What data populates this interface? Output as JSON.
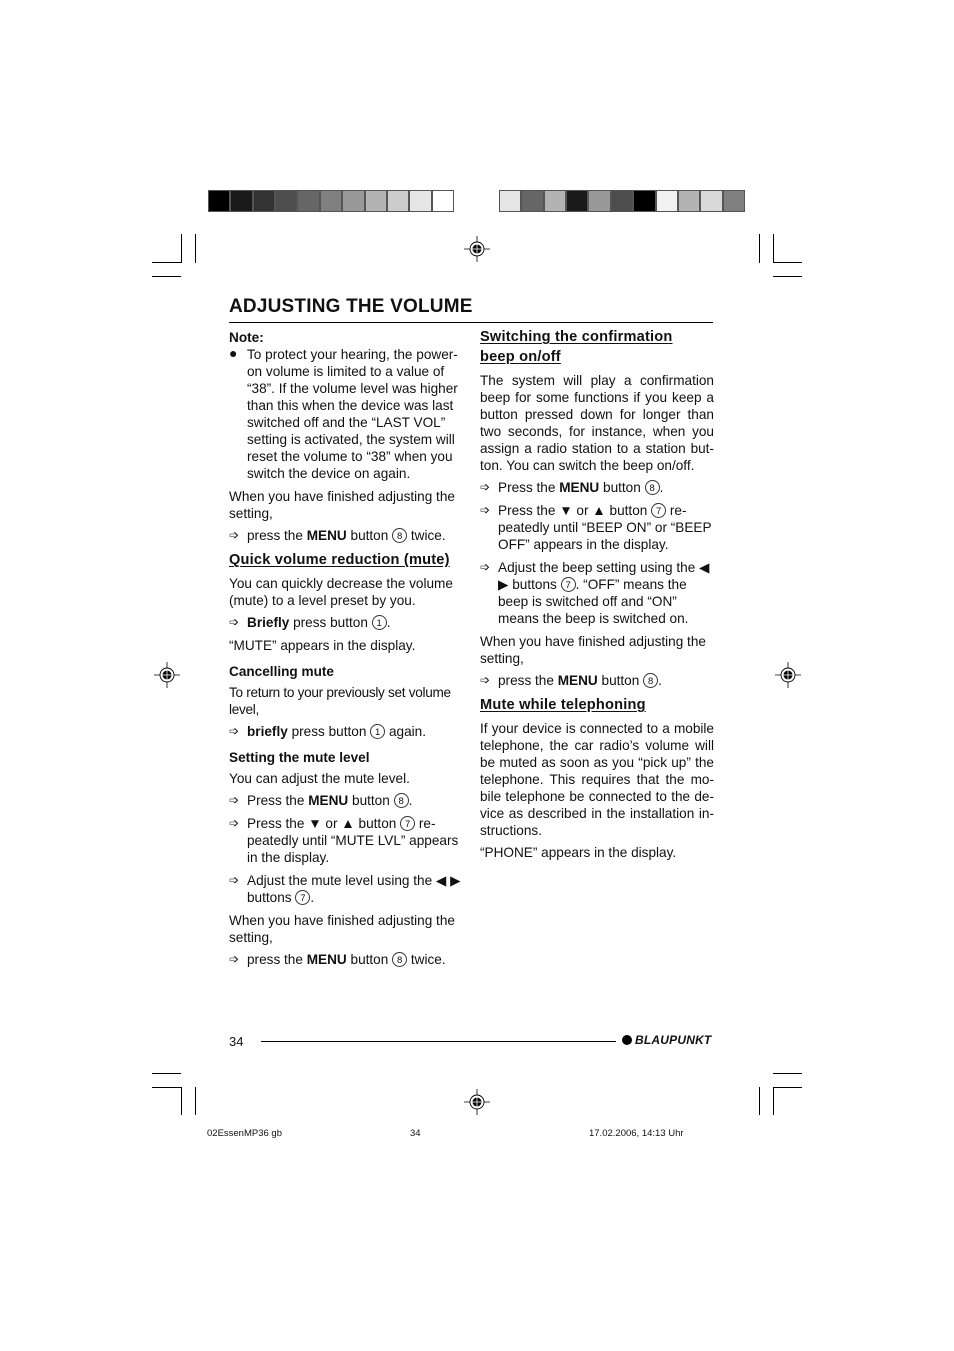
{
  "print_marks": {
    "color_bar_left": [
      "#000000",
      "#1a1a1a",
      "#333333",
      "#4d4d4d",
      "#666666",
      "#808080",
      "#999999",
      "#b3b3b3",
      "#cccccc",
      "#e6e6e6",
      "#ffffff"
    ],
    "color_bar_right": [
      "#e6e6e6",
      "#666666",
      "#b3b3b3",
      "#1a1a1a",
      "#999999",
      "#4d4d4d",
      "#000000",
      "#f2f2f2",
      "#b3b3b3",
      "#d9d9d9",
      "#808080"
    ]
  },
  "page": {
    "title": "ADJUSTING THE VOLUME",
    "left": {
      "note_label": "Note:",
      "note_bullet": "To protect your hearing, the pow­er-on volume is limited to a value of “38”. If the volume level was higher than this when the device was last switched off and the “LAST VOL” setting is activated, the system will reset the volume to “38” when you switch the device on again.",
      "finish_text": "When you have finished adjusting the setting,",
      "finish_step": {
        "pre": "press the ",
        "bold": "MENU",
        "mid": " button ",
        "num": "8",
        "post": " twice."
      },
      "mute_heading": "Quick volume reduction (mute)",
      "mute_text": "You can quickly decrease the volume (mute) to a level preset by you.",
      "mute_step": {
        "bold": "Briefly",
        "mid": " press button ",
        "num": "1",
        "post": "."
      },
      "mute_display": "“MUTE” appears in the display.",
      "cancel_heading": "Cancelling mute",
      "cancel_text": "To return to your previously set volume level,",
      "cancel_step": {
        "bold": "briefly",
        "mid": " press button ",
        "num": "1",
        "post": " again."
      },
      "level_heading": "Setting the mute level",
      "level_text": "You can adjust the mute level.",
      "level_step1": {
        "pre": "Press the ",
        "bold": "MENU",
        "mid": " button ",
        "num": "8",
        "post": "."
      },
      "level_step2": {
        "pre": "Press the ▼ or ▲ button ",
        "num": "7",
        "post": " re­peatedly until “MUTE LVL” ap­pears in the display."
      },
      "level_step3": {
        "pre": "Adjust the mute level using the ◀ ▶ buttons ",
        "num": "7",
        "post": "."
      },
      "finish_text2": "When you have finished adjusting the setting,",
      "finish_step2": {
        "pre": "press the ",
        "bold": "MENU",
        "mid": " button ",
        "num": "8",
        "post": " twice."
      }
    },
    "right": {
      "beep_heading": "Switching the confirmation beep on/off",
      "beep_text": "The system will play a confirmation beep for some functions if you keep a button pressed down for longer than two seconds, for instance, when you assign a radio station to a station but­ton. You can switch the beep on/off.",
      "beep_step1": {
        "pre": "Press the ",
        "bold": "MENU",
        "mid": " button ",
        "num": "8",
        "post": "."
      },
      "beep_step2": {
        "pre": "Press the ▼ or ▲ button ",
        "num": "7",
        "post": " re­peatedly until “BEEP ON” or “BEEP OFF” appears in the dis­play."
      },
      "beep_step3": {
        "pre": "Adjust the beep setting using the ◀ ▶ buttons ",
        "num": "7",
        "post": ". “OFF” means the beep is switched off and “ON” means the beep is switched on."
      },
      "finish_text": "When you have finished adjusting the setting,",
      "finish_step": {
        "pre": "press the ",
        "bold": "MENU",
        "mid": " button ",
        "num": "8",
        "post": "."
      },
      "phone_heading": "Mute while telephoning",
      "phone_text": "If your device is connected to a mobile telephone, the car radio’s volume will be muted as soon as you “pick up” the telephone. This requires that the mo­bile telephone be connected to the de­vice as described in the installation in­structions.",
      "phone_display": "“PHONE” appears in the display."
    },
    "footer": {
      "page_number": "34",
      "brand": "BLAUPUNKT"
    }
  },
  "slug": {
    "file": "02EssenMP36 gb",
    "page": "34",
    "date": "17.02.2006, 14:13 Uhr"
  },
  "icons": {
    "step_arrow": "➩",
    "bullet": "●"
  }
}
